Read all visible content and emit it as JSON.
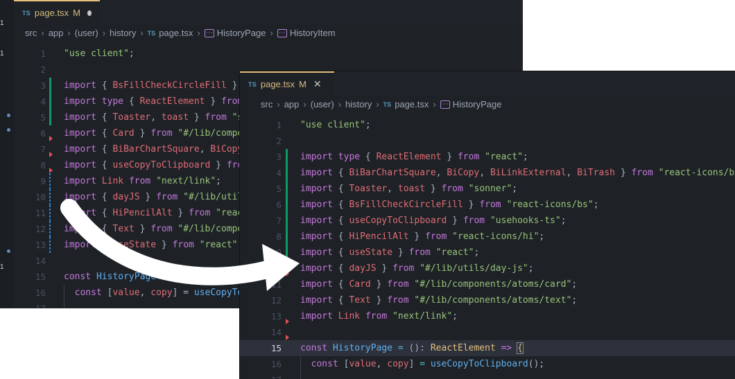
{
  "back_editor": {
    "tab": {
      "lang": "TS",
      "filename": "page.tsx",
      "modified": "M"
    },
    "breadcrumb": [
      "src",
      "app",
      "(user)",
      "history",
      "page.tsx",
      "HistoryPage",
      "HistoryItem"
    ],
    "activity_number": "1",
    "lines": [
      {
        "n": "1",
        "html": "<span class='str'>\"use client\"</span>;"
      },
      {
        "n": "2",
        "html": ""
      },
      {
        "n": "3",
        "html": "<span class='kw'>import</span> { <span class='var'>BsFillCheckCircleFill</span> }"
      },
      {
        "n": "4",
        "html": "<span class='kw'>import type</span> { <span class='var'>ReactElement</span> } <span class='kw'>from</span>"
      },
      {
        "n": "5",
        "html": "<span class='kw'>import</span> { <span class='var'>Toaster</span>, <span class='var'>toast</span> } <span class='kw'>from</span> <span class='str'>\"s</span>"
      },
      {
        "n": "6",
        "html": "<span class='kw'>import</span> { <span class='var'>Card</span> } <span class='kw'>from</span> <span class='str'>\"#/lib/compo</span>"
      },
      {
        "n": "7",
        "html": "<span class='kw'>import</span> { <span class='var'>BiBarChartSquare</span>, <span class='var'>BiCopy</span>"
      },
      {
        "n": "8",
        "html": "<span class='kw'>import</span> { <span class='var'>useCopyToClipboard</span> } <span class='kw'>fro</span>"
      },
      {
        "n": "9",
        "html": "<span class='kw'>import</span> <span class='var'>Link</span> <span class='kw'>from</span> <span class='str'>\"next/link\"</span>;"
      },
      {
        "n": "10",
        "html": "<span class='kw'>import</span> { <span class='var'>dayJS</span> } <span class='kw'>from</span> <span class='str'>\"#/lib/util</span>"
      },
      {
        "n": "11",
        "html": "<span class='kw'>import</span> { <span class='var'>HiPencilAlt</span> } <span class='kw'>from</span> <span class='str'>\"reac</span>"
      },
      {
        "n": "12",
        "html": "<span class='kw'>import</span> { <span class='var'>Text</span> } <span class='kw'>from</span> <span class='str'>\"#/lib/compo</span>"
      },
      {
        "n": "13",
        "html": "<span class='kw'>import</span> { <span class='var'>useState</span> } <span class='kw'>from</span> <span class='str'>\"react\"</span>;"
      },
      {
        "n": "14",
        "html": ""
      },
      {
        "n": "15",
        "html": "<span class='kw'>const</span> <span class='fn'>HistoryPage</span> = (): <span class='ty'>ReactElem</span>"
      },
      {
        "n": "16",
        "html": "  <span class='kw'>const</span> [<span class='var'>value</span>, <span class='var'>copy</span>] = <span class='fn'>useCopyTo</span>"
      },
      {
        "n": "17",
        "html": ""
      }
    ]
  },
  "front_editor": {
    "tab": {
      "lang": "TS",
      "filename": "page.tsx",
      "modified": "M",
      "close": "✕"
    },
    "breadcrumb": [
      "src",
      "app",
      "(user)",
      "history",
      "page.tsx",
      "HistoryPage"
    ],
    "lines": [
      {
        "n": "1",
        "html": "<span class='str'>\"use client\"</span>;"
      },
      {
        "n": "2",
        "html": ""
      },
      {
        "n": "3",
        "html": "<span class='kw'>import type</span> { <span class='var'>ReactElement</span> } <span class='kw'>from</span> <span class='str'>\"react\"</span>;"
      },
      {
        "n": "4",
        "html": "<span class='kw'>import</span> { <span class='var'>BiBarChartSquare</span>, <span class='var'>BiCopy</span>, <span class='var'>BiLinkExternal</span>, <span class='var'>BiTrash</span> } <span class='kw'>from</span> <span class='str'>\"react-icons/bi\"</span>"
      },
      {
        "n": "5",
        "html": "<span class='kw'>import</span> { <span class='var'>Toaster</span>, <span class='var'>toast</span> } <span class='kw'>from</span> <span class='str'>\"sonner\"</span>;"
      },
      {
        "n": "6",
        "html": "<span class='kw'>import</span> { <span class='var'>BsFillCheckCircleFill</span> } <span class='kw'>from</span> <span class='str'>\"react-icons/bs\"</span>;"
      },
      {
        "n": "7",
        "html": "<span class='kw'>import</span> { <span class='var'>useCopyToClipboard</span> } <span class='kw'>from</span> <span class='str'>\"usehooks-ts\"</span>;"
      },
      {
        "n": "8",
        "html": "<span class='kw'>import</span> { <span class='var'>HiPencilAlt</span> } <span class='kw'>from</span> <span class='str'>\"react-icons/hi\"</span>;"
      },
      {
        "n": "9",
        "html": "<span class='kw'>import</span> { <span class='var'>useState</span> } <span class='kw'>from</span> <span class='str'>\"react\"</span>;"
      },
      {
        "n": "10",
        "html": "<span class='kw'>import</span> { <span class='var'>dayJS</span> } <span class='kw'>from</span> <span class='str'>\"#/lib/utils/day-js\"</span>;"
      },
      {
        "n": "11",
        "html": "<span class='kw'>import</span> { <span class='var'>Card</span> } <span class='kw'>from</span> <span class='str'>\"#/lib/components/atoms/card\"</span>;"
      },
      {
        "n": "12",
        "html": "<span class='kw'>import</span> { <span class='var'>Text</span> } <span class='kw'>from</span> <span class='str'>\"#/lib/components/atoms/text\"</span>;"
      },
      {
        "n": "13",
        "html": "<span class='kw'>import</span> <span class='var'>Link</span> <span class='kw'>from</span> <span class='str'>\"next/link\"</span>;"
      },
      {
        "n": "14",
        "html": ""
      },
      {
        "n": "15",
        "html": "<span class='kw'>const</span> <span class='fn'>HistoryPage</span> <span class='op'>=</span> (): <span class='ty'>ReactElement</span> <span class='kw'>=></span> <span class='br2'>{</span>"
      },
      {
        "n": "16",
        "html": "  <span class='kw'>const</span> [<span class='var'>value</span>, <span class='var'>copy</span>] <span class='op'>=</span> <span class='fn'>useCopyToClipboard</span>();"
      },
      {
        "n": "17",
        "html": ""
      }
    ]
  },
  "colors": {
    "editor_bg": "#1e2227",
    "keyword": "#c678dd",
    "string": "#98c379",
    "function": "#61afef",
    "type": "#e5c07b",
    "variable": "#e06c75",
    "git_added": "#109868",
    "git_modified": "#2a82d6",
    "arrow": "#ffffff"
  }
}
